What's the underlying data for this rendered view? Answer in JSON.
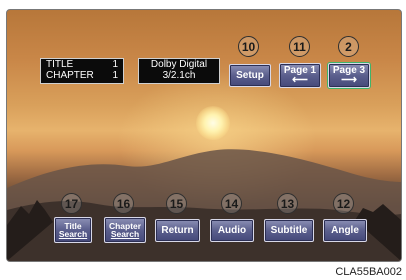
{
  "info": {
    "title_label": "TITLE",
    "title_value": "1",
    "chapter_label": "CHAPTER",
    "chapter_value": "1",
    "audio_line1": "Dolby Digital",
    "audio_line2": "3/2.1ch"
  },
  "buttons": {
    "setup": "Setup",
    "page1": "Page 1",
    "page1_arrow": "⟵",
    "page3": "Page 3",
    "page3_arrow": "⟶",
    "title_search_1": "Title",
    "title_search_2": "Search",
    "chapter_search_1": "Chapter",
    "chapter_search_2": "Search",
    "return": "Return",
    "audio": "Audio",
    "subtitle": "Subtitle",
    "angle": "Angle"
  },
  "callouts": {
    "c10": "10",
    "c11": "11",
    "c2": "2",
    "c17": "17",
    "c16": "16",
    "c15": "15",
    "c14": "14",
    "c13": "13",
    "c12": "12"
  },
  "figure_code": "CLA55BA002",
  "colors": {
    "button_top": "#8c90b5",
    "button_bottom": "#45497a",
    "page3_highlight": "#3fb36a"
  }
}
